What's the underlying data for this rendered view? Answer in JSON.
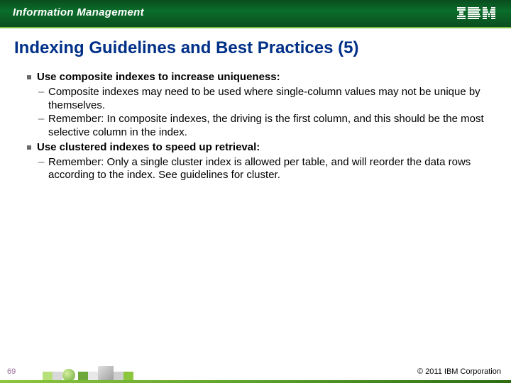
{
  "header": {
    "brand": "Information Management",
    "logo_label": "IBM"
  },
  "slide": {
    "title": "Indexing Guidelines and Best Practices (5)",
    "bullets": [
      {
        "lead": "Use composite indexes to increase uniqueness:",
        "subs": [
          "Composite indexes may need to be used where single-column values may not be unique by themselves.",
          "Remember: In composite indexes, the driving is the first column, and this should be the most selective column in the index."
        ]
      },
      {
        "lead": "Use clustered indexes to speed up retrieval:",
        "subs": [
          "Remember: Only a single cluster index is allowed per table, and will reorder the data rows according to the index. See guidelines for cluster."
        ]
      }
    ]
  },
  "footer": {
    "page": "69",
    "copyright": "© 2011 IBM Corporation"
  }
}
